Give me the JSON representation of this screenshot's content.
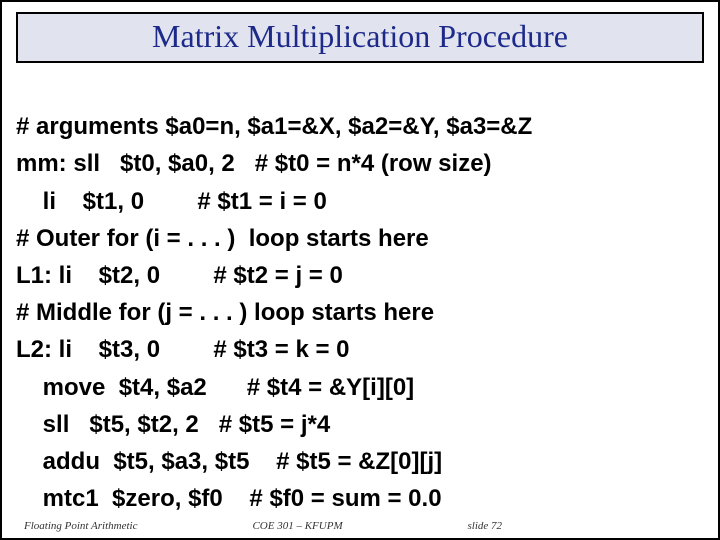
{
  "title": "Matrix Multiplication Procedure",
  "code": {
    "l0": "# arguments $a0=n, $a1=&X, $a2=&Y, $a3=&Z",
    "l1": "mm: sll   $t0, $a0, 2   # $t0 = n*4 (row size)",
    "l2": "    li    $t1, 0        # $t1 = i = 0",
    "l3": "# Outer for (i = . . . )  loop starts here",
    "l4": "L1: li    $t2, 0        # $t2 = j = 0",
    "l5": "# Middle for (j = . . . ) loop starts here",
    "l6": "L2: li    $t3, 0        # $t3 = k = 0",
    "l7": "    move  $t4, $a2      # $t4 = &Y[i][0]",
    "l8": "    sll   $t5, $t2, 2   # $t5 = j*4",
    "l9": "    addu  $t5, $a3, $t5    # $t5 = &Z[0][j]",
    "l10": "    mtc1  $zero, $f0    # $f0 = sum = 0.0"
  },
  "footer": {
    "left": "Floating Point Arithmetic",
    "center": "COE 301 – KFUPM",
    "right": "slide 72"
  }
}
